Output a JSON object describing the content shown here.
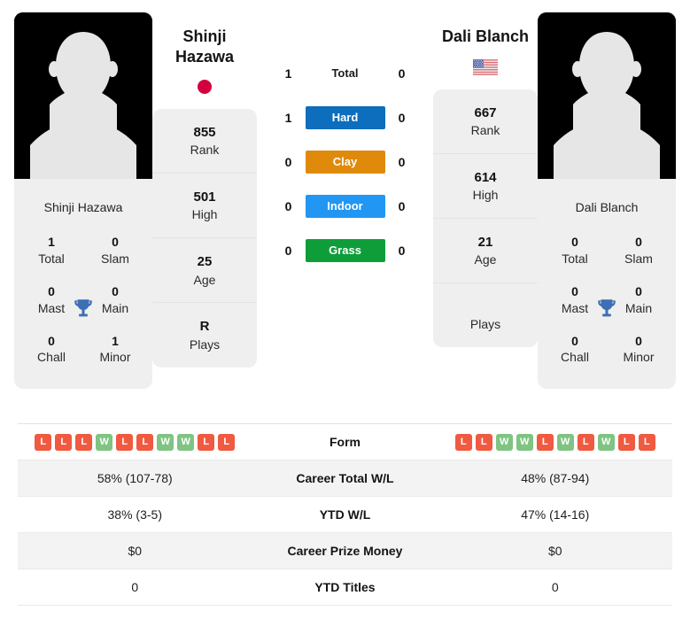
{
  "players": {
    "left": {
      "name_line1": "Shinji",
      "name_line2": "Hazawa",
      "full_name": "Shinji Hazawa",
      "flag": "japan-flag",
      "flag_color": "#d3003f",
      "stats": [
        {
          "value": "855",
          "label": "Rank"
        },
        {
          "value": "501",
          "label": "High"
        },
        {
          "value": "25",
          "label": "Age"
        },
        {
          "value": "R",
          "label": "Plays"
        }
      ],
      "titles": [
        {
          "value": "1",
          "label": "Total"
        },
        {
          "value": "0",
          "label": "Slam"
        },
        {
          "value": "0",
          "label": "Mast"
        },
        {
          "value": "0",
          "label": "Main"
        },
        {
          "value": "0",
          "label": "Chall"
        },
        {
          "value": "1",
          "label": "Minor"
        }
      ],
      "form": [
        "L",
        "L",
        "L",
        "W",
        "L",
        "L",
        "W",
        "W",
        "L",
        "L"
      ],
      "career_wl": "58% (107-78)",
      "ytd_wl": "38% (3-5)",
      "career_prize": "$0",
      "ytd_titles": "0"
    },
    "right": {
      "name_line1": "Dali Blanch",
      "name_line2": "",
      "full_name": "Dali Blanch",
      "flag": "usa-flag",
      "stats": [
        {
          "value": "667",
          "label": "Rank"
        },
        {
          "value": "614",
          "label": "High"
        },
        {
          "value": "21",
          "label": "Age"
        },
        {
          "value": "",
          "label": "Plays"
        }
      ],
      "titles": [
        {
          "value": "0",
          "label": "Total"
        },
        {
          "value": "0",
          "label": "Slam"
        },
        {
          "value": "0",
          "label": "Mast"
        },
        {
          "value": "0",
          "label": "Main"
        },
        {
          "value": "0",
          "label": "Chall"
        },
        {
          "value": "0",
          "label": "Minor"
        }
      ],
      "form": [
        "L",
        "L",
        "W",
        "W",
        "L",
        "W",
        "L",
        "W",
        "L",
        "L"
      ],
      "career_wl": "48% (87-94)",
      "ytd_wl": "47% (14-16)",
      "career_prize": "$0",
      "ytd_titles": "0"
    }
  },
  "h2h": [
    {
      "label": "Total",
      "left": "1",
      "right": "0",
      "badge": false,
      "color": ""
    },
    {
      "label": "Hard",
      "left": "1",
      "right": "0",
      "badge": true,
      "color": "#0d6ebd"
    },
    {
      "label": "Clay",
      "left": "0",
      "right": "0",
      "badge": true,
      "color": "#e08a0b"
    },
    {
      "label": "Indoor",
      "left": "0",
      "right": "0",
      "badge": true,
      "color": "#2196f3"
    },
    {
      "label": "Grass",
      "left": "0",
      "right": "0",
      "badge": true,
      "color": "#0f9d3a"
    }
  ],
  "table": {
    "rows": [
      {
        "label": "Form",
        "type": "form",
        "left": "",
        "right": ""
      },
      {
        "label": "Career Total W/L",
        "type": "text",
        "left": "58% (107-78)",
        "right": "48% (87-94)"
      },
      {
        "label": "YTD W/L",
        "type": "text",
        "left": "38% (3-5)",
        "right": "47% (14-16)"
      },
      {
        "label": "Career Prize Money",
        "type": "text",
        "left": "$0",
        "right": "$0"
      },
      {
        "label": "YTD Titles",
        "type": "text",
        "left": "0",
        "right": "0"
      }
    ]
  },
  "colors": {
    "win": "#7fc482",
    "loss": "#f05a40",
    "trophy": "#3d6fb5",
    "card_bg": "#efefef"
  }
}
